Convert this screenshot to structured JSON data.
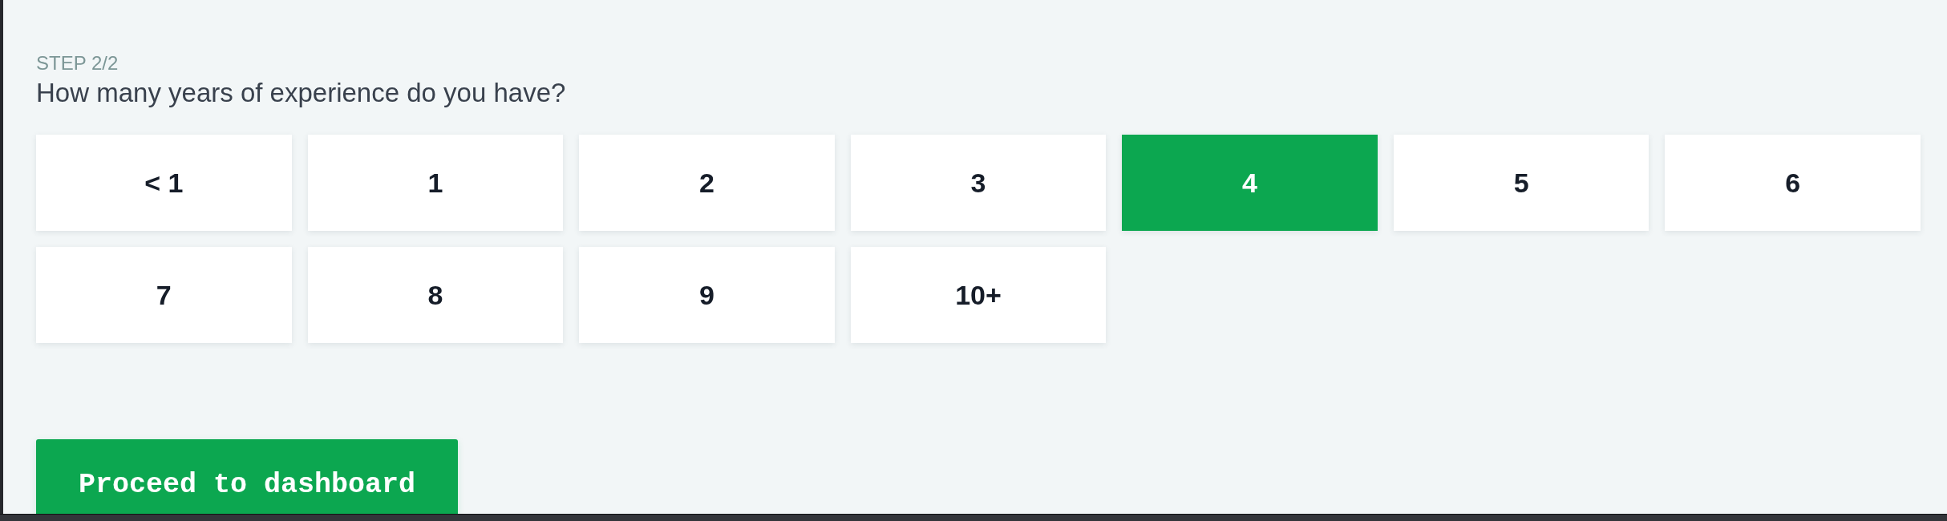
{
  "step_label": "STEP 2/2",
  "question": "How many years of experience do you have?",
  "options": [
    {
      "label": "< 1",
      "selected": false
    },
    {
      "label": "1",
      "selected": false
    },
    {
      "label": "2",
      "selected": false
    },
    {
      "label": "3",
      "selected": false
    },
    {
      "label": "4",
      "selected": true
    },
    {
      "label": "5",
      "selected": false
    },
    {
      "label": "6",
      "selected": false
    },
    {
      "label": "7",
      "selected": false
    },
    {
      "label": "8",
      "selected": false
    },
    {
      "label": "9",
      "selected": false
    },
    {
      "label": "10+",
      "selected": false
    }
  ],
  "proceed_button": {
    "label": "Proceed to dashboard"
  }
}
